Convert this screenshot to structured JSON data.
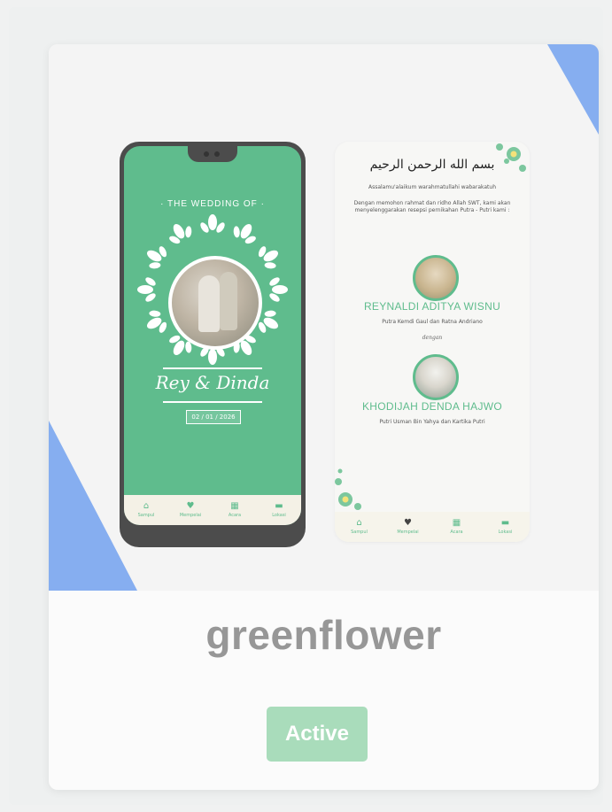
{
  "template": {
    "name": "greenflower",
    "action_label": "Active"
  },
  "preview": {
    "phone_main": {
      "heading": "· THE WEDDING OF ·",
      "couple": "Rey & Dinda",
      "date": "02 / 01 / 2026"
    },
    "phone_detail": {
      "arabic": "بسم الله الرحمن الرحيم",
      "greeting": "Assalamu'alaikum warahmatullahi wabarakatuh",
      "intro": "Dengan memohon rahmat dan ridho Allah SWT, kami akan menyelenggarakan resepsi pernikahan Putra - Putri kami :",
      "groom_name": "REYNALDI ADITYA WISNU",
      "groom_parents": "Putra Kemdi Gaul dan Ratna Andriano",
      "separator": "dengan",
      "bride_name": "KHODIJAH DENDA HAJWO",
      "bride_parents": "Putri Usman Bin Yahya dan Kartika Putri"
    },
    "nav": [
      {
        "icon": "home-icon",
        "glyph": "⌂",
        "label": "Sampul"
      },
      {
        "icon": "heart-icon",
        "glyph": "♥",
        "label": "Mempelai"
      },
      {
        "icon": "calendar-icon",
        "glyph": "▦",
        "label": "Acara"
      },
      {
        "icon": "chat-icon",
        "glyph": "▬",
        "label": "Lokasi"
      }
    ]
  },
  "colors": {
    "accent_green": "#5fbc8d",
    "active_button": "#a9dcbb",
    "triangle_blue": "#86aef0",
    "title_gray": "#979797"
  }
}
